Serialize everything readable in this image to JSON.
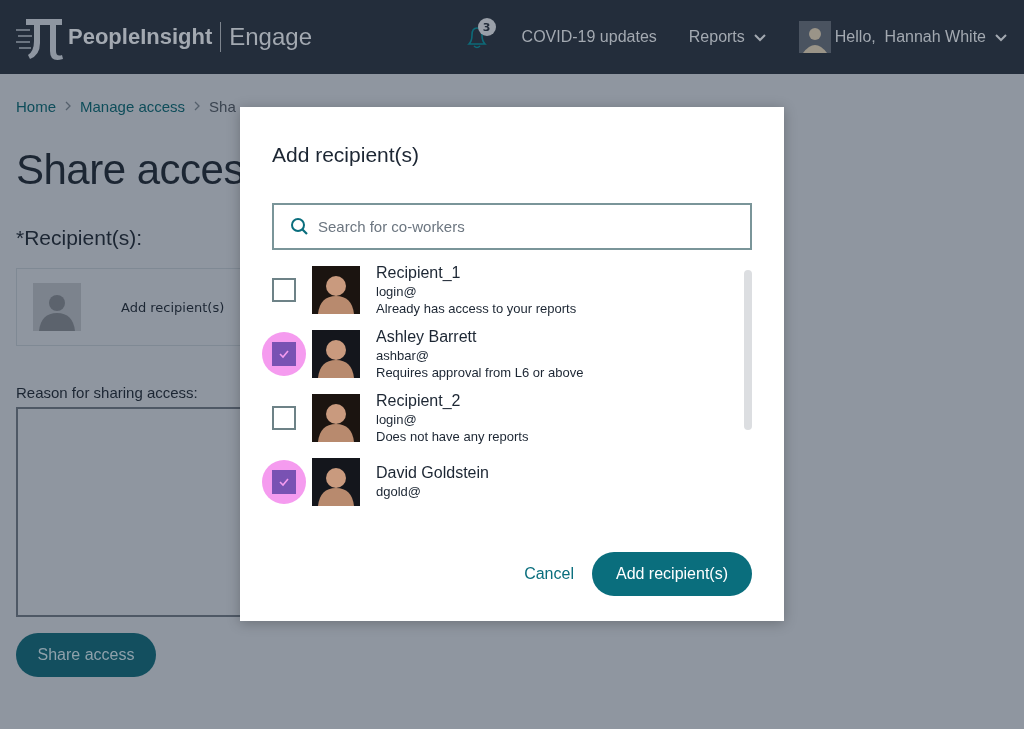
{
  "nav": {
    "brand": "PeopleInsight",
    "product": "Engage",
    "notifications": "3",
    "links": [
      {
        "label": "COVID-19 updates",
        "kind": "link"
      },
      {
        "label": "Reports",
        "kind": "menu"
      }
    ],
    "greeting": "Hello,  Hannah White"
  },
  "breadcrumb": [
    "Home",
    "Manage access",
    "Sha"
  ],
  "page": {
    "title": "Share acces",
    "recipients_label": "*Recipient(s):",
    "add_recipients": "Add recipient(s)",
    "reason_label": "Reason for sharing access:",
    "submit": "Share access"
  },
  "dialog": {
    "title": "Add recipient(s)",
    "search": {
      "placeholder": "Search for co-workers"
    },
    "recipients": [
      {
        "name": "Recipient_1",
        "login": "login@",
        "note": "Already has access to your reports",
        "selected": false
      },
      {
        "name": "Ashley Barrett",
        "login": "ashbar@",
        "note": "Requires approval from L6 or above",
        "selected": true
      },
      {
        "name": "Recipient_2",
        "login": "login@",
        "note": "Does not have any reports",
        "selected": false
      },
      {
        "name": "David Goldstein",
        "login": "dgold@",
        "selected": true
      }
    ],
    "buttons": [
      {
        "label": "Cancel",
        "kind": "link"
      },
      {
        "label": "Add recipient(s)",
        "kind": "primary"
      }
    ]
  }
}
